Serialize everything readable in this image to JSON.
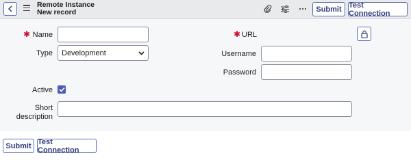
{
  "header": {
    "title": "Remote Instance",
    "subtitle": "New record",
    "submit_label": "Submit",
    "test_connection_label": "Test Connection",
    "icons": [
      "back-icon",
      "menu-icon",
      "paperclip-icon",
      "sliders-icon",
      "more-icon"
    ]
  },
  "form": {
    "name": {
      "label": "Name",
      "value": "",
      "required": true
    },
    "type": {
      "label": "Type",
      "selected": "Development"
    },
    "url": {
      "label": "URL",
      "required": true
    },
    "username": {
      "label": "Username",
      "value": ""
    },
    "password": {
      "label": "Password",
      "value": ""
    },
    "active": {
      "label": "Active",
      "checked": true
    },
    "short_description": {
      "label_line1": "Short",
      "label_line2": "description",
      "value": ""
    }
  },
  "footer": {
    "submit_label": "Submit",
    "test_connection_label": "Test Connection"
  },
  "colors": {
    "accent": "#4f5bb5",
    "required": "#c8102e",
    "header_bg": "#e9eaec",
    "form_bg": "#f6f7f8"
  }
}
